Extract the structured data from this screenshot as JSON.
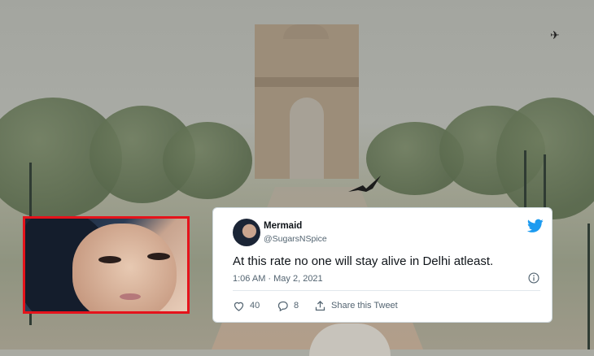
{
  "tweet": {
    "name": "Mermaid",
    "handle": "@SugarsNSpice",
    "text": "At this rate no one will stay alive in Delhi atleast.",
    "timestamp": "1:06 AM · May 2, 2021",
    "likes": "40",
    "replies": "8",
    "share_label": "Share this Tweet"
  },
  "icons": {
    "twitter": "twitter-bird-icon",
    "info": "info-icon",
    "like": "heart-icon",
    "reply": "reply-icon",
    "share": "share-icon"
  },
  "colors": {
    "photo_border": "#e5131b",
    "twitter_blue": "#1d9bf0",
    "muted_text": "#536471"
  }
}
